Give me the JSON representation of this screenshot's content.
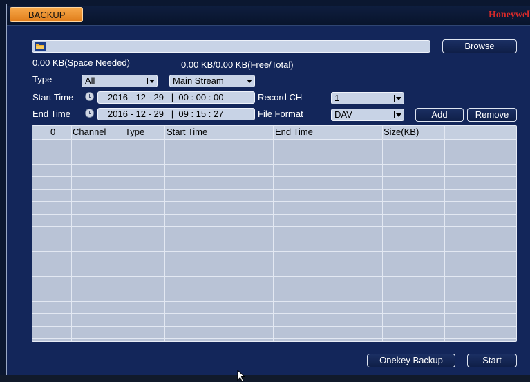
{
  "window": {
    "tab_label": "BACKUP",
    "brand": "Honeywell"
  },
  "storage": {
    "space_needed": "0.00 KB(Space Needed)",
    "free_total": "0.00 KB/0.00 KB(Free/Total)",
    "path_value": ""
  },
  "buttons": {
    "browse": "Browse",
    "add": "Add",
    "remove": "Remove",
    "onekey_backup": "Onekey Backup",
    "start": "Start"
  },
  "filters": {
    "type_label": "Type",
    "type_value": "All",
    "stream_value": "Main Stream",
    "start_time_label": "Start Time",
    "start_date": "2016 - 12 - 29",
    "start_time": "00 : 00 : 00",
    "end_time_label": "End Time",
    "end_date": "2016 - 12 - 29",
    "end_time": "09 : 15 : 27",
    "record_ch_label": "Record CH",
    "record_ch_value": "1",
    "file_format_label": "File Format",
    "file_format_value": "DAV"
  },
  "table": {
    "columns": [
      "0",
      "Channel",
      "Type",
      "Start Time",
      "End Time",
      "Size(KB)",
      ""
    ],
    "rows": []
  },
  "icons": {
    "folder": "folder-icon",
    "clock": "clock-icon",
    "dropdown": "dropdown-arrow-icon",
    "cursor": "mouse-cursor-icon"
  }
}
